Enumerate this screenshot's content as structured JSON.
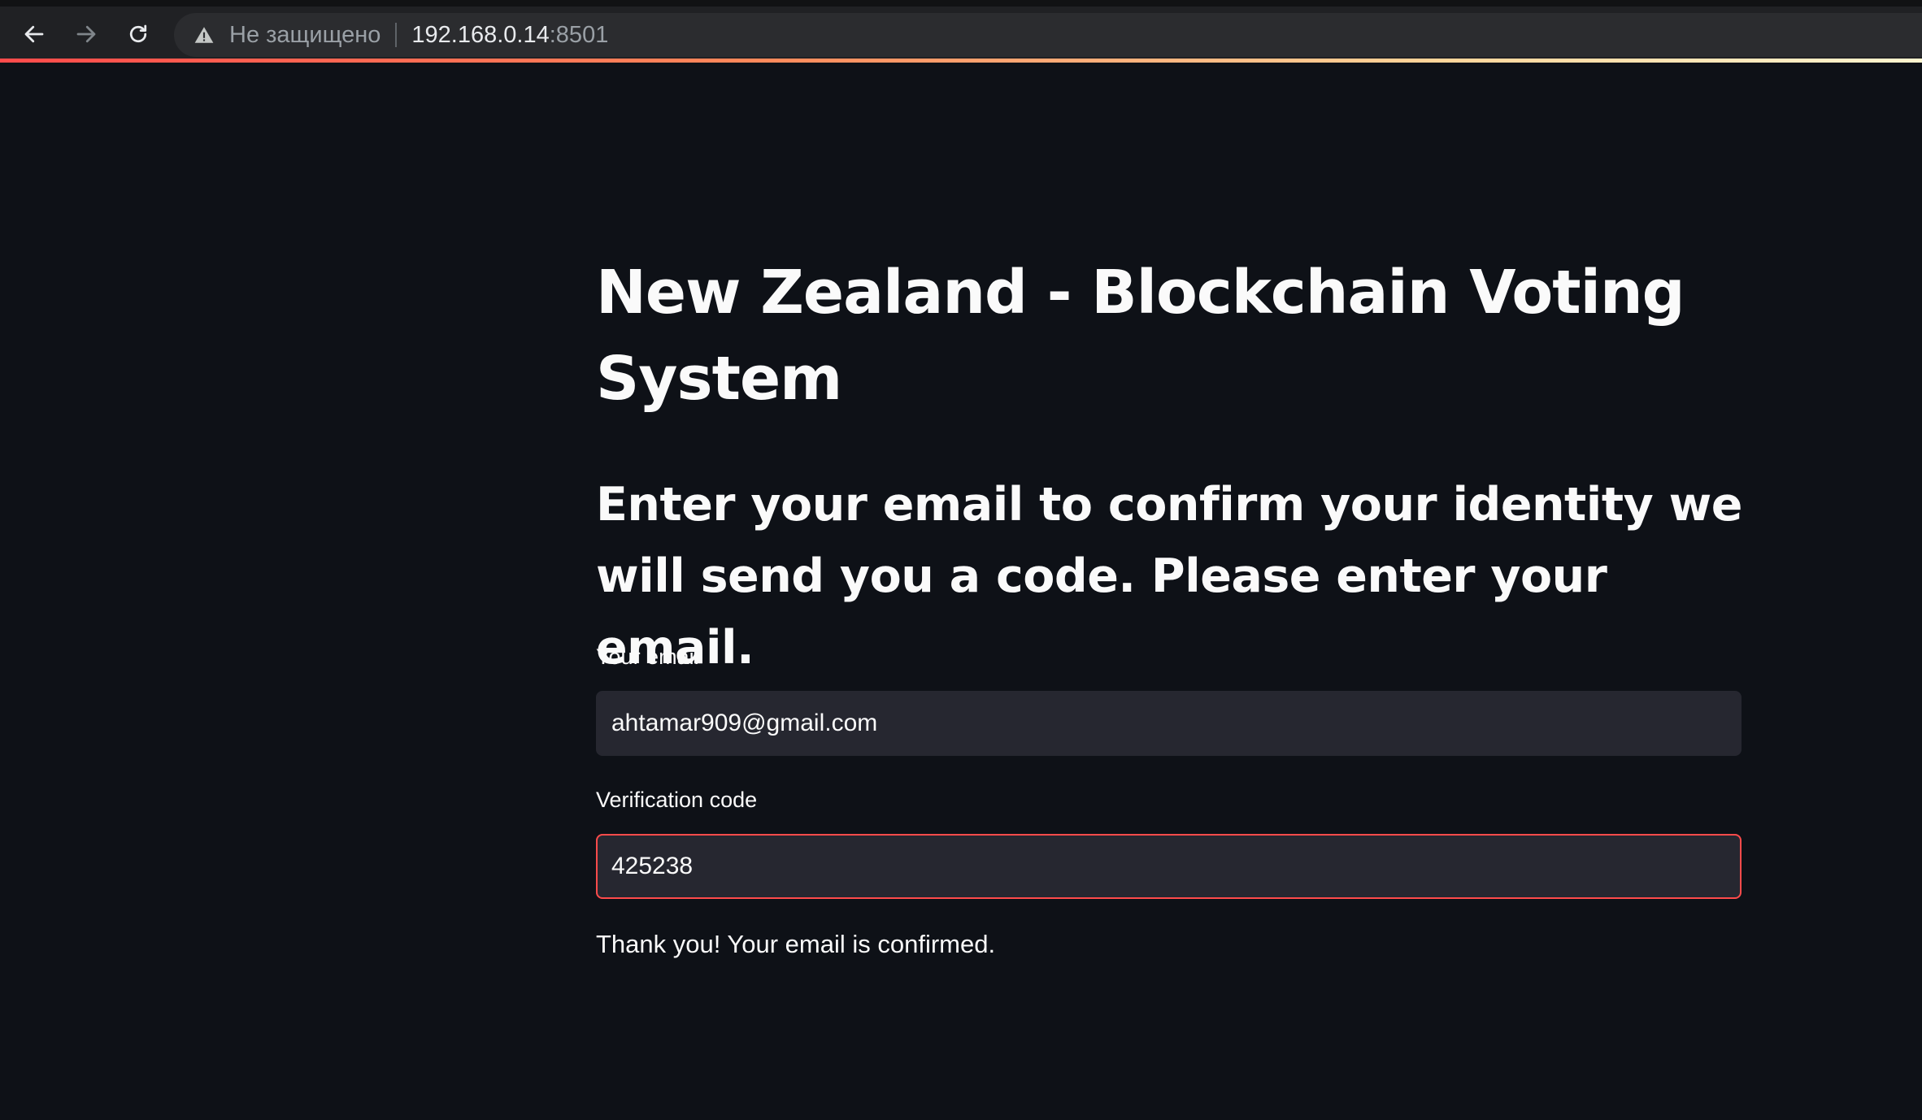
{
  "browser": {
    "insecure_label": "Не защищено",
    "url_host": "192.168.0.14",
    "url_port": ":8501"
  },
  "page": {
    "title": "New Zealand - Blockchain Voting System",
    "subtitle": "Enter your email to confirm your identity we will send you a code. Please enter your email."
  },
  "form": {
    "email_label": "Your email",
    "email_value": "ahtamar909@gmail.com",
    "code_label": "Verification code",
    "code_value": "425238",
    "confirmation_message": "Thank you! Your email is confirmed."
  },
  "colors": {
    "background": "#0e1117",
    "input_background": "#262730",
    "accent": "#ff4b4b",
    "text": "#fafafa"
  }
}
